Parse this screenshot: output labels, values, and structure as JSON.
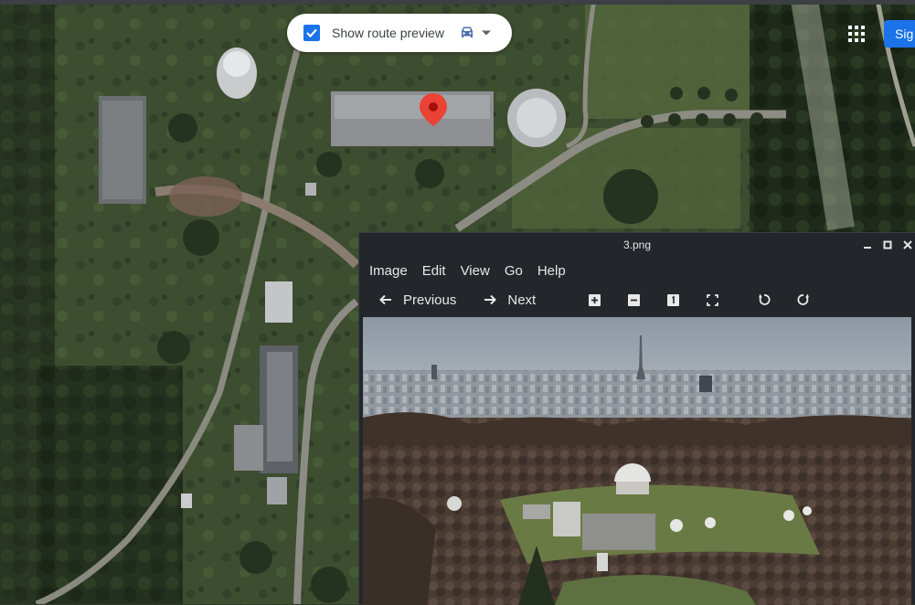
{
  "map": {
    "route_preview_label": "Show route preview",
    "route_preview_checked": true,
    "signin_label": "Sig",
    "accent_color": "#1a73e8",
    "pin_color": "#ea4335",
    "icons": [
      "checkbox-checked-icon",
      "car-icon",
      "caret-down-icon",
      "apps-grid-icon",
      "map-pin-icon"
    ]
  },
  "viewer": {
    "title": "3.png",
    "menu": [
      "Image",
      "Edit",
      "View",
      "Go",
      "Help"
    ],
    "toolbar": {
      "previous_label": "Previous",
      "next_label": "Next",
      "icons": [
        "arrow-left-icon",
        "arrow-right-icon",
        "zoom-in-icon",
        "zoom-out-icon",
        "actual-size-icon",
        "fullscreen-icon",
        "rotate-left-icon",
        "rotate-right-icon"
      ]
    },
    "window_controls": [
      "minimize-icon",
      "maximize-icon",
      "close-icon"
    ]
  }
}
